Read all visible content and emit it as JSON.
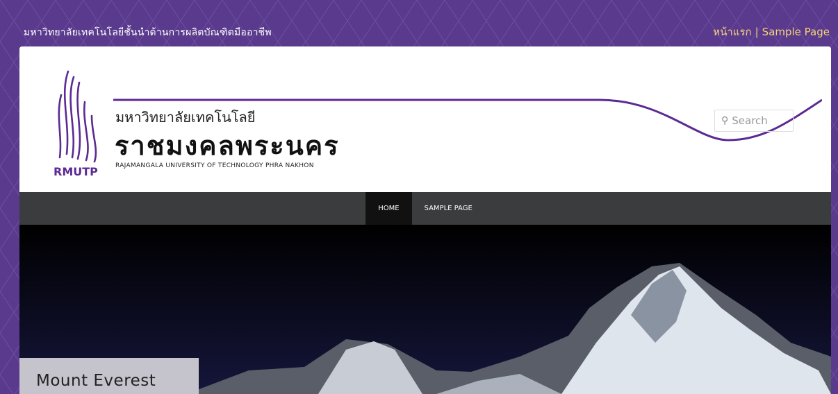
{
  "topbar": {
    "tagline": "มหาวิทยาลัยเทคโนโลยีชั้นนำด้านการผลิตบัณฑิตมืออาชีพ",
    "links": [
      {
        "label": "หน้าแรก"
      },
      {
        "label": "Sample Page"
      }
    ],
    "separator": "|"
  },
  "brand": {
    "logo_text": "RMUTP",
    "thai_small": "มหาวิทยาลัยเทคโนโลยี",
    "thai_big": "ราชมงคลพระนคร",
    "english": "RAJAMANGALA UNIVERSITY OF TECHNOLOGY PHRA NAKHON"
  },
  "search": {
    "placeholder": "Search",
    "icon": "search-icon"
  },
  "nav": {
    "items": [
      {
        "label": "HOME",
        "active": true
      },
      {
        "label": "SAMPLE PAGE",
        "active": false
      }
    ]
  },
  "slider": {
    "caption": "Mount Everest"
  },
  "colors": {
    "brand_purple": "#5a3a8c",
    "nav_bg": "#3b3c3e",
    "link_gold": "#f3d27a"
  }
}
